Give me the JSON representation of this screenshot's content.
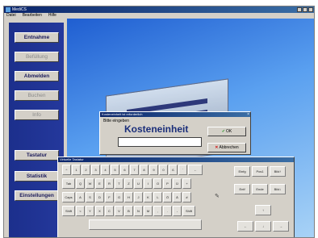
{
  "window": {
    "title": "MediCS",
    "menu": [
      "Datei",
      "Bearbeiten",
      "Hilfe"
    ]
  },
  "sidebar": {
    "items": [
      {
        "label": "Entnahme",
        "enabled": true
      },
      {
        "label": "Befüllung",
        "enabled": false
      },
      {
        "label": "Abmelden",
        "enabled": true
      },
      {
        "label": "Buchen",
        "enabled": false
      },
      {
        "label": "Info",
        "enabled": false
      },
      {
        "label": "Tastatur",
        "enabled": true
      },
      {
        "label": "Statistik",
        "enabled": true
      },
      {
        "label": "Einstellungen",
        "enabled": true
      }
    ]
  },
  "dialog": {
    "title": "Kosteneinheit ist erforderlich",
    "prompt": "Bitte eingeben",
    "heading": "Kosteneinheit",
    "input_value": "",
    "ok_label": "OK",
    "cancel_label": "Abbrechen"
  },
  "keyboard": {
    "title": "Virtuelle Tastatur",
    "rows": [
      [
        "^",
        "1",
        "2",
        "3",
        "4",
        "5",
        "6",
        "7",
        "8",
        "9",
        "0",
        "ß",
        "´",
        "←"
      ],
      [
        "Tab",
        "Q",
        "W",
        "E",
        "R",
        "T",
        "Z",
        "U",
        "I",
        "O",
        "P",
        "Ü",
        "+"
      ],
      [
        "Caps",
        "A",
        "S",
        "D",
        "F",
        "G",
        "H",
        "J",
        "K",
        "L",
        "Ö",
        "Ä",
        "#"
      ],
      [
        "Shift",
        "<",
        "Y",
        "X",
        "C",
        "V",
        "B",
        "N",
        "M",
        ",",
        ".",
        "-",
        "Shift"
      ]
    ],
    "nav_keys": [
      [
        "Einfg",
        "Pos1",
        "Bild↑"
      ],
      [
        "Entf",
        "Ende",
        "Bild↓"
      ]
    ],
    "arrows": [
      "↑",
      "←",
      "↓",
      "→"
    ]
  },
  "colors": {
    "sidebar": "#1c2f8c",
    "titlebar": "#0a246a",
    "desktop": "#5aa0f0"
  }
}
